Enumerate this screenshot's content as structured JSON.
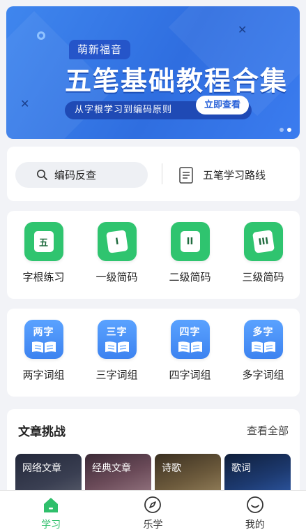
{
  "banner": {
    "tag": "萌新福音",
    "title": "五笔基础教程合集",
    "subtitle": "从字根学习到编码原则",
    "cta": "立即查看",
    "page_count": 2,
    "active_page": 2
  },
  "search": {
    "code_lookup": "编码反查",
    "learning_route": "五笔学习路线"
  },
  "practice": [
    {
      "glyph": "五",
      "label": "字根练习"
    },
    {
      "glyph": "I",
      "label": "一级简码"
    },
    {
      "glyph": "II",
      "label": "二级简码"
    },
    {
      "glyph": "III",
      "label": "三级简码"
    }
  ],
  "phrases": [
    {
      "tile": "两字",
      "label": "两字词组"
    },
    {
      "tile": "三字",
      "label": "三字词组"
    },
    {
      "tile": "四字",
      "label": "四字词组"
    },
    {
      "tile": "多字",
      "label": "多字词组"
    }
  ],
  "articles": {
    "heading": "文章挑战",
    "see_all": "查看全部",
    "items": [
      "网络文章",
      "经典文章",
      "诗歌",
      "歌词"
    ]
  },
  "nav": [
    {
      "label": "学习",
      "icon": "home-icon",
      "active": true
    },
    {
      "label": "乐学",
      "icon": "compass-icon",
      "active": false
    },
    {
      "label": "我的",
      "icon": "smile-icon",
      "active": false
    }
  ],
  "colors": {
    "brand_blue": "#3f86ee",
    "green": "#2fc46f",
    "active_nav": "#2fbf6b"
  }
}
